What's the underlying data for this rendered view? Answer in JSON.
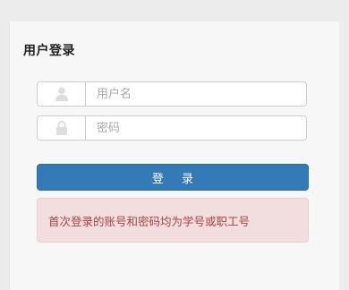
{
  "panel": {
    "title": "用户登录"
  },
  "form": {
    "username": {
      "placeholder": "用户名",
      "value": "",
      "icon": "user-icon"
    },
    "password": {
      "placeholder": "密码",
      "value": "",
      "icon": "lock-icon"
    },
    "login_label": "登 录"
  },
  "alert": {
    "message": "首次登录的账号和密码均为学号或职工号"
  },
  "colors": {
    "primary": "#337ab7",
    "alert_bg": "#f2dede",
    "alert_text": "#a94442",
    "icon_gray": "#dddddd"
  }
}
